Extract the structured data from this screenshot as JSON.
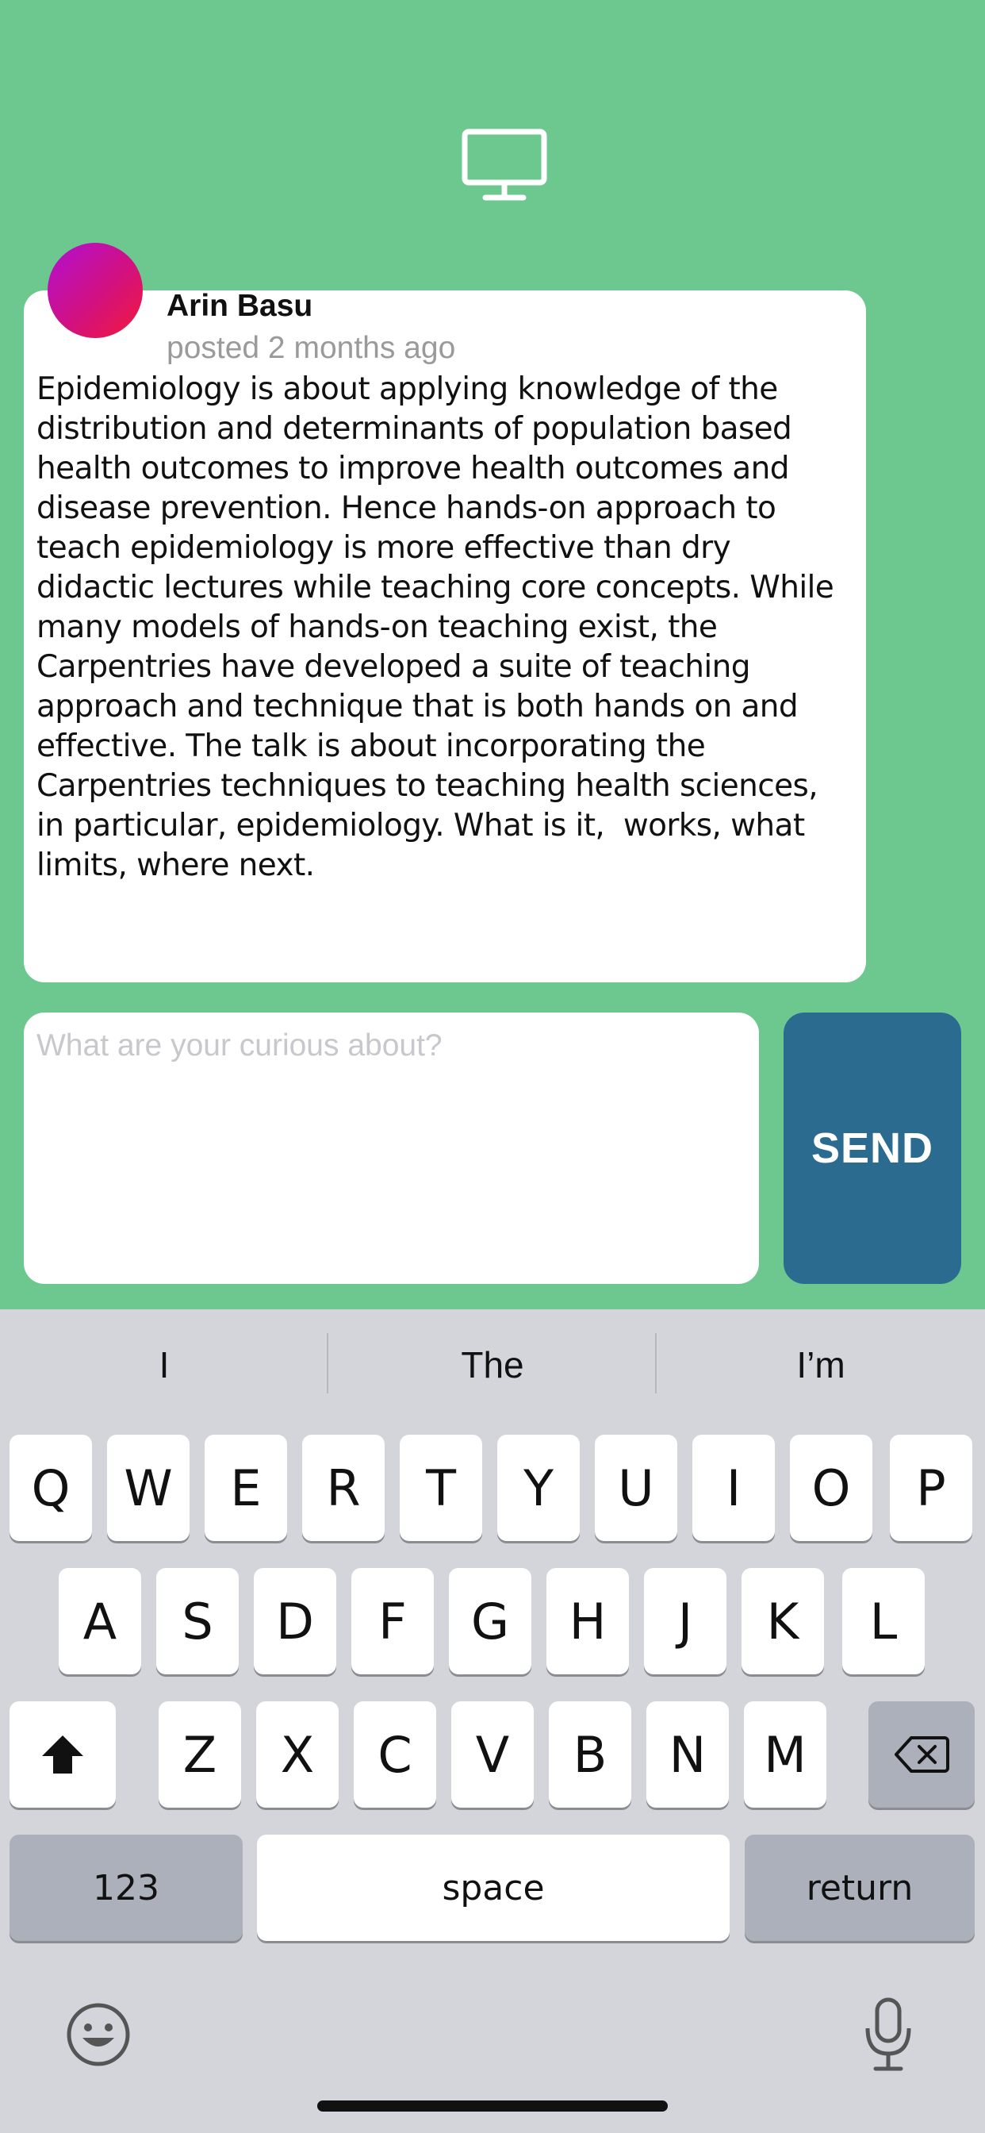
{
  "header": {
    "icon": "monitor-icon"
  },
  "post": {
    "author": "Arin Basu",
    "posted": "posted 2 months ago",
    "body": "Epidemiology is about applying knowledge of the\ndistribution and determinants of population based\nhealth outcomes to improve health outcomes and\ndisease prevention. Hence hands-on approach to\nteach epidemiology is more effective than dry\ndidactic lectures while teaching core concepts. While\nmany models of hands-on teaching exist, the\nCarpentries have developed a suite of teaching\napproach and technique that is both hands on and\neffective. The talk is about incorporating the\nCarpentries techniques to teaching health sciences,\nin particular, epidemiology. What is it,  works, what\nlimits, where next."
  },
  "composer": {
    "placeholder": "What are your curious about?",
    "value": "",
    "send_label": "SEND"
  },
  "keyboard": {
    "suggestions": [
      "I",
      "The",
      "I’m"
    ],
    "row1": [
      "Q",
      "W",
      "E",
      "R",
      "T",
      "Y",
      "U",
      "I",
      "O",
      "P"
    ],
    "row2": [
      "A",
      "S",
      "D",
      "F",
      "G",
      "H",
      "J",
      "K",
      "L"
    ],
    "row3": [
      "Z",
      "X",
      "C",
      "V",
      "B",
      "N",
      "M"
    ],
    "numbers_label": "123",
    "space_label": "space",
    "return_label": "return"
  },
  "colors": {
    "background": "#6cc88f",
    "send_button": "#2c6b90",
    "avatar_gradient": [
      "#b10fd3",
      "#f31a3a"
    ]
  }
}
